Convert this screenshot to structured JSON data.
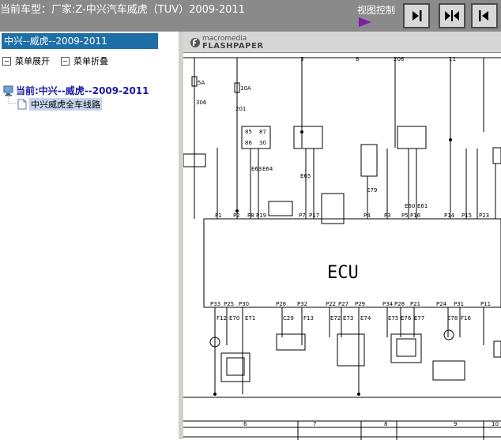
{
  "topbar": {
    "title": "当前车型：厂家:Z-中兴汽车威虎（TUV）2009-2011",
    "view_control_label": "视图控制",
    "buttons": [
      "next-page-icon",
      "fit-page-icon",
      "prev-page-icon"
    ]
  },
  "sidebar": {
    "header": "中兴--威虎--2009-2011",
    "expand_label": "菜单展开",
    "collapse_label": "菜单折叠",
    "tree_root": "当前:中兴--威虎--2009-2011",
    "tree_child": "中兴威虎全车线路"
  },
  "viewer": {
    "logo_small": "macromedia",
    "logo_brand": "FLASHPAPER",
    "ecu_label": "ECU",
    "top_numbers": [
      "3",
      "8",
      "206",
      "11"
    ],
    "fuse_labels": [
      "5A",
      "10A"
    ],
    "wire_numbers": [
      "306",
      "201"
    ],
    "ecu_top_pins": [
      "P1",
      "P2",
      "P8",
      "P19",
      "P7",
      "P17",
      "P4",
      "P3",
      "P5",
      "P16",
      "P14",
      "P15",
      "P23"
    ],
    "ecu_bottom_pins": [
      "P33",
      "P25",
      "P30",
      "P26",
      "P32",
      "P22",
      "P27",
      "P29",
      "P34",
      "P28",
      "P21",
      "P24",
      "P31",
      "P11"
    ],
    "connector_labels": [
      "F12",
      "E70",
      "E71",
      "C29",
      "F13",
      "E72",
      "E73",
      "E74",
      "E75",
      "E76",
      "E77",
      "E78",
      "F16"
    ],
    "relay_labels": [
      "85",
      "86",
      "87",
      "30"
    ],
    "misc_labels": [
      "E63",
      "E64",
      "E65",
      "E60",
      "E61",
      "E79"
    ],
    "grid_numbers": [
      "6",
      "7",
      "8",
      "9",
      "10"
    ]
  }
}
